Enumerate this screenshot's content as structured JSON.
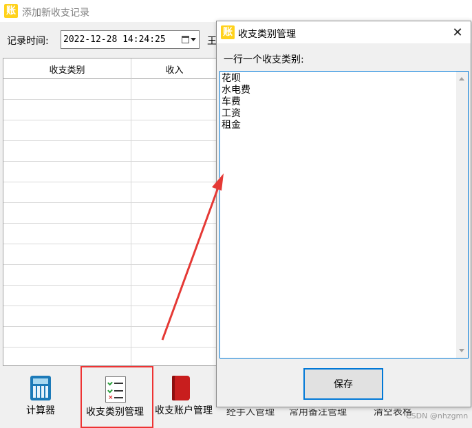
{
  "main_window": {
    "title": "添加新收支记录",
    "app_icon_text": "账",
    "record_time_label": "记录时间:",
    "record_time_value": "2022-12-28 14:24:25",
    "partial_label": "王",
    "table": {
      "columns": [
        "收支类别",
        "收入"
      ]
    }
  },
  "toolbar": {
    "calculator": "计算器",
    "category_manage": "收支类别管理",
    "account_manage": "收支账户管理",
    "handler_manage": "经手人管理",
    "note_manage": "常用备注管理",
    "clear_table": "清空表格"
  },
  "dialog": {
    "title": "收支类别管理",
    "prompt": "一行一个收支类别:",
    "categories": [
      "花呗",
      "水电费",
      "车费",
      "工资",
      "租金"
    ],
    "save_label": "保存"
  },
  "watermark": "CSDN @nhzgmn",
  "colors": {
    "highlight_box": "#e33333",
    "arrow": "#e53935",
    "focus": "#0078d7",
    "app_icon": "#ffd21c"
  }
}
